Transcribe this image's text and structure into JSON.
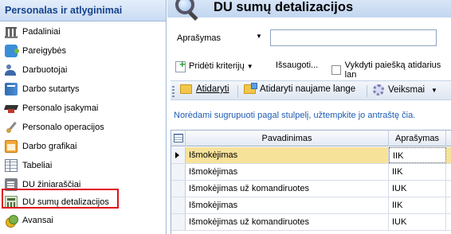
{
  "nav": {
    "header": "Personalas ir atlyginimai",
    "items": [
      {
        "label": "Padaliniai",
        "icon": "building-icon"
      },
      {
        "label": "Pareigybės",
        "icon": "puzzle-icon"
      },
      {
        "label": "Darbuotojai",
        "icon": "people-icon"
      },
      {
        "label": "Darbo sutartys",
        "icon": "contract-book-icon"
      },
      {
        "label": "Personalo įsakymai",
        "icon": "graduation-cap-icon"
      },
      {
        "label": "Personalo operacijos",
        "icon": "tools-icon"
      },
      {
        "label": "Darbo grafikai",
        "icon": "calendar-icon"
      },
      {
        "label": "Tabeliai",
        "icon": "timesheet-icon"
      },
      {
        "label": "DU žiniaraščiai",
        "icon": "ledger-icon"
      },
      {
        "label": "DU sumų detalizacijos",
        "icon": "calculator-icon",
        "highlighted": true
      },
      {
        "label": "Avansai",
        "icon": "coins-icon"
      }
    ],
    "highlight_color": "#e0101a"
  },
  "main": {
    "title": "DU sumų detalizacijos",
    "filter": {
      "label": "Aprašymas",
      "value": "",
      "placeholder": ""
    },
    "criteria": {
      "add_label": "Pridėti kriterijų",
      "save_label": "Išsaugoti...",
      "search_checkbox_label": "Vykdyti paiešką atidarius lan"
    },
    "toolbar": {
      "open_label": "Atidaryti",
      "open_new_label": "Atidaryti naujame lange",
      "actions_label": "Veiksmai"
    },
    "info_text": "Norėdami sugrupuoti pagal stulpelį, užtempkite jo antraštę čia.",
    "grid": {
      "columns": [
        "Pavadinimas",
        "Aprašymas"
      ],
      "rows": [
        {
          "name": "Išmokėjimas",
          "desc": "IIK",
          "selected": true
        },
        {
          "name": "Išmokėjimas",
          "desc": "IIK",
          "selected": false
        },
        {
          "name": "Išmokėjimas už komandiruotes",
          "desc": "IUK",
          "selected": false
        },
        {
          "name": "Išmokėjimas",
          "desc": "IIK",
          "selected": false
        },
        {
          "name": "Išmokėjimas už komandiruotes",
          "desc": "IUK",
          "selected": false
        }
      ]
    },
    "colors": {
      "title_bar": "#c2d6f0",
      "info_text": "#1e5cb3",
      "selected_row": "#f7e29a"
    }
  }
}
